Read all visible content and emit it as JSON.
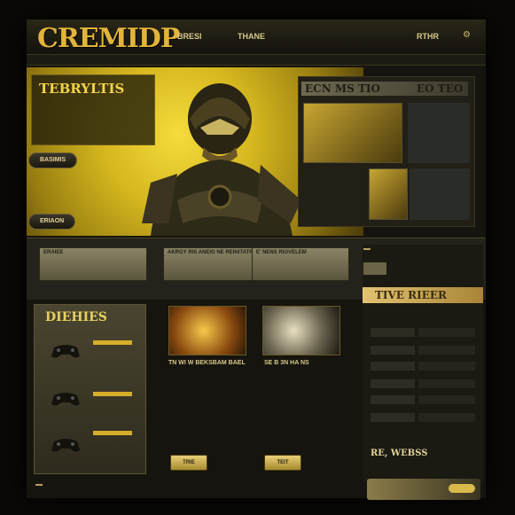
{
  "header": {
    "logo_small": "",
    "logo": "CREMIDP",
    "nav": [
      "BRESI",
      "THANE",
      "RTHR"
    ]
  },
  "subnav": [
    "",
    "",
    "",
    "",
    "",
    "",
    "",
    ""
  ],
  "hero": {
    "title": "TEBRYLTIS",
    "text": "",
    "button1": "BASIMIS",
    "button2": "ERIAON"
  },
  "showcase": {
    "title_left": "ECN MS TIO",
    "title_right": "EO TEO",
    "thumb1_text": "",
    "thumb2_text": ""
  },
  "features": [
    {
      "label": "ERAIEE",
      "sub": ""
    },
    {
      "label": "AKRGY RIS ANEIO NE REINITATROS",
      "sub": ""
    },
    {
      "label": "E' NENS RIOVELEM",
      "sub": ""
    }
  ],
  "games": {
    "title": "DIEHIES",
    "items": [
      "",
      "",
      ""
    ]
  },
  "articles": [
    {
      "title": "TN WI W BEKSBAM BAEL",
      "body": "",
      "button": "TRIE"
    },
    {
      "title": "SE B 3N HA NS",
      "body": "",
      "button": "TEIT"
    }
  ],
  "sidebar": {
    "top_label": "",
    "top_small": [
      "",
      ""
    ],
    "title": "TIVE RIEER",
    "header": "",
    "rows": [
      {
        "l": "",
        "r": ""
      },
      {
        "l": "",
        "r": ""
      },
      {
        "l": "",
        "r": ""
      },
      {
        "l": "",
        "r": ""
      },
      {
        "l": "",
        "r": ""
      },
      {
        "l": "",
        "r": ""
      }
    ],
    "footer_title": "RE, WEBSS",
    "footer_label": "",
    "footer_btn": ""
  },
  "footer": {
    "left_btn": ""
  },
  "colors": {
    "accent": "#e2b43a",
    "bg": "#0a0906",
    "panel": "#1a1912"
  }
}
